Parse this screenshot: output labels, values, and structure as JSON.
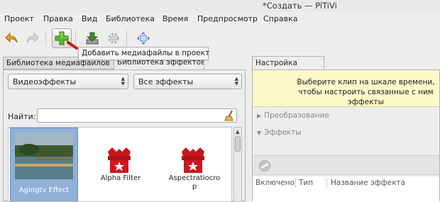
{
  "window": {
    "title": "*Создать — PiTiVi"
  },
  "menu": [
    "Проект",
    "Правка",
    "Вид",
    "Библиотека",
    "Время",
    "Предпросмотр",
    "Справка"
  ],
  "toolbar": {
    "tooltip": "Добавить медиафайлы в проект"
  },
  "left_pane": {
    "tabs": [
      "Библиотека медиафайлов",
      "Библиотека эффектов"
    ],
    "category_combo": "Видеоэффекты",
    "filter_combo": "Все эффекты",
    "search_label": "Найти:",
    "search_value": "",
    "effects": [
      {
        "label": "Agingtv Effect",
        "icon": "aging-thumbnail-image"
      },
      {
        "label": "Alpha Filter",
        "icon": "gift-box-icon"
      },
      {
        "label": "Aspectratiocro\np",
        "icon": "gift-box-icon"
      }
    ]
  },
  "right_pane": {
    "tab": "Настройка клипа",
    "info": "Выберите клип на шкале времени, чтобы настроить связанные с ним эффекты",
    "expanders": [
      "Преобразование",
      "Эффекты"
    ],
    "columns": [
      "Включено",
      "Тип",
      "Название эффекта"
    ]
  },
  "colors": {
    "selection": "#8fb0d9",
    "info_bg": "#fbf8c9",
    "gift_red": "#c8151c"
  }
}
